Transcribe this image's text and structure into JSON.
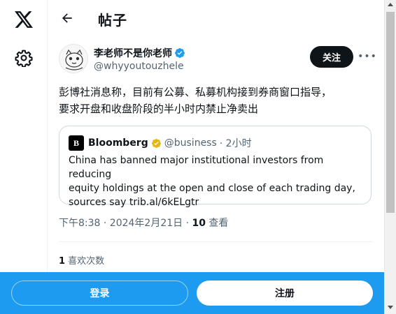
{
  "header": {
    "title": "帖子"
  },
  "icons": {
    "logo": "x-logo-icon",
    "settings": "gear-icon",
    "back": "arrow-left-icon",
    "verified": "verified-badge-icon",
    "more": "more-icon"
  },
  "post": {
    "author_name": "李老师不是你老师",
    "author_handle": "@whyyoutouzhele",
    "follow_label": "关注",
    "more_label": "•••",
    "text_line1": "彭博社消息称，目前有公募、私募机构接到券商窗口指导，",
    "text_line2": "要求开盘和收盘阶段的半小时内禁止净卖出",
    "quote": {
      "logo_letter": "B",
      "name": "Bloomberg",
      "handle": "@business",
      "time": "· 2小时",
      "line1": "China has banned major institutional investors from reducing",
      "line2": "equity holdings at the open and close of each trading day,",
      "line3": "sources say trib.al/6kELgtr"
    },
    "timestamp": "下午8:38 · 2024年2月21日 · ",
    "views_count": "10",
    "views_label": " 查看",
    "likes_count": "1",
    "likes_label": " 喜欢次数"
  },
  "bottom_bar": {
    "login_label": "登录",
    "signup_label": "注册"
  },
  "colors": {
    "accent": "#1d9bf0",
    "text": "#0f1419",
    "muted": "#536471",
    "gold": "#e2b719"
  }
}
